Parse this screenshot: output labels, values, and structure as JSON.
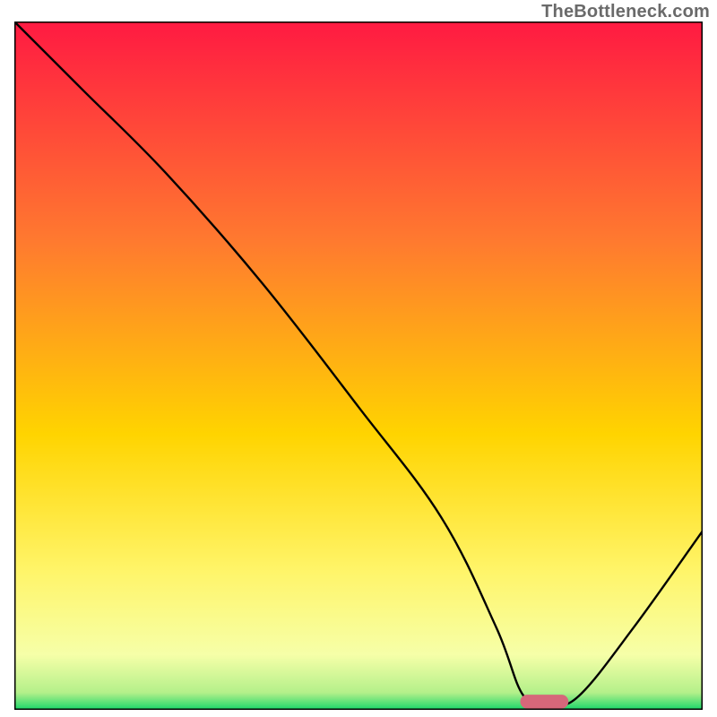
{
  "watermark": "TheBottleneck.com",
  "chart_data": {
    "type": "line",
    "title": "",
    "xlabel": "",
    "ylabel": "",
    "xlim": [
      0,
      100
    ],
    "ylim": [
      0,
      100
    ],
    "grid": false,
    "legend": false,
    "background_gradient": {
      "stops": [
        {
          "offset": 0.0,
          "color": "#ff1a42"
        },
        {
          "offset": 0.32,
          "color": "#ff7a2f"
        },
        {
          "offset": 0.6,
          "color": "#ffd400"
        },
        {
          "offset": 0.8,
          "color": "#fff56a"
        },
        {
          "offset": 0.92,
          "color": "#f6ffa8"
        },
        {
          "offset": 0.975,
          "color": "#b4f08a"
        },
        {
          "offset": 1.0,
          "color": "#18d66a"
        }
      ]
    },
    "series": [
      {
        "name": "bottleneck-curve",
        "x": [
          0,
          10,
          22,
          36,
          50,
          62,
          70,
          74,
          78,
          82,
          90,
          100
        ],
        "y": [
          100,
          90,
          78,
          62,
          44,
          28,
          12,
          2,
          1,
          2,
          12,
          26
        ]
      }
    ],
    "markers": [
      {
        "name": "optimal-range-bar",
        "shape": "rounded-rect",
        "x_start": 73.5,
        "x_end": 80.5,
        "y": 1.2,
        "height": 2.0,
        "color": "#d6677a"
      }
    ]
  }
}
